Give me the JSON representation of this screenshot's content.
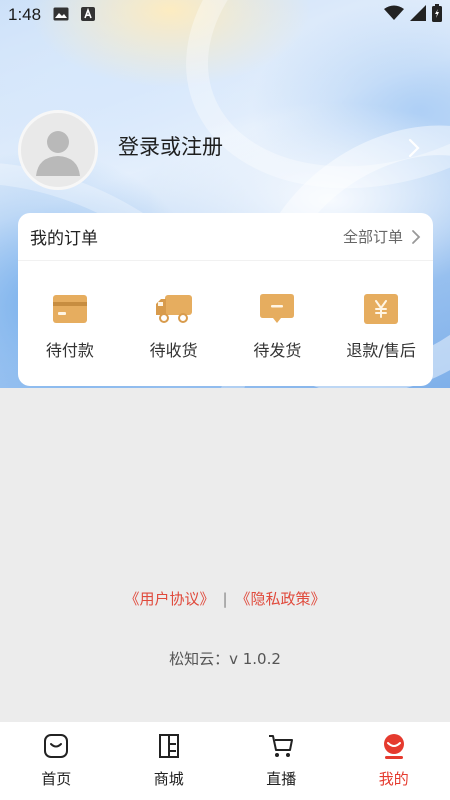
{
  "status_bar": {
    "time": "1:48",
    "icons": [
      "image-icon",
      "a-badge-icon",
      "wifi-icon",
      "signal-icon",
      "battery-icon"
    ]
  },
  "profile": {
    "login_label": "登录或注册",
    "avatar_icon": "user-silhouette-icon"
  },
  "orders": {
    "title": "我的订单",
    "all_label": "全部订单",
    "items": [
      {
        "label": "待付款",
        "icon": "card-icon"
      },
      {
        "label": "待收货",
        "icon": "truck-icon"
      },
      {
        "label": "待发货",
        "icon": "message-box-icon"
      },
      {
        "label": "退款/售后",
        "icon": "yen-icon"
      }
    ]
  },
  "footer": {
    "user_agreement": "《用户协议》",
    "separator": "|",
    "privacy_policy": "《隐私政策》",
    "version": "松知云：v 1.0.2"
  },
  "tabbar": {
    "active_index": 3,
    "tabs": [
      {
        "label": "首页",
        "icon": "home-bag-icon"
      },
      {
        "label": "商城",
        "icon": "store-icon"
      },
      {
        "label": "直播",
        "icon": "cart-icon"
      },
      {
        "label": "我的",
        "icon": "profile-face-icon"
      }
    ]
  },
  "colors": {
    "accent": "#e53a2e",
    "order_icon": "#e0a85a",
    "background": "#ececec"
  }
}
